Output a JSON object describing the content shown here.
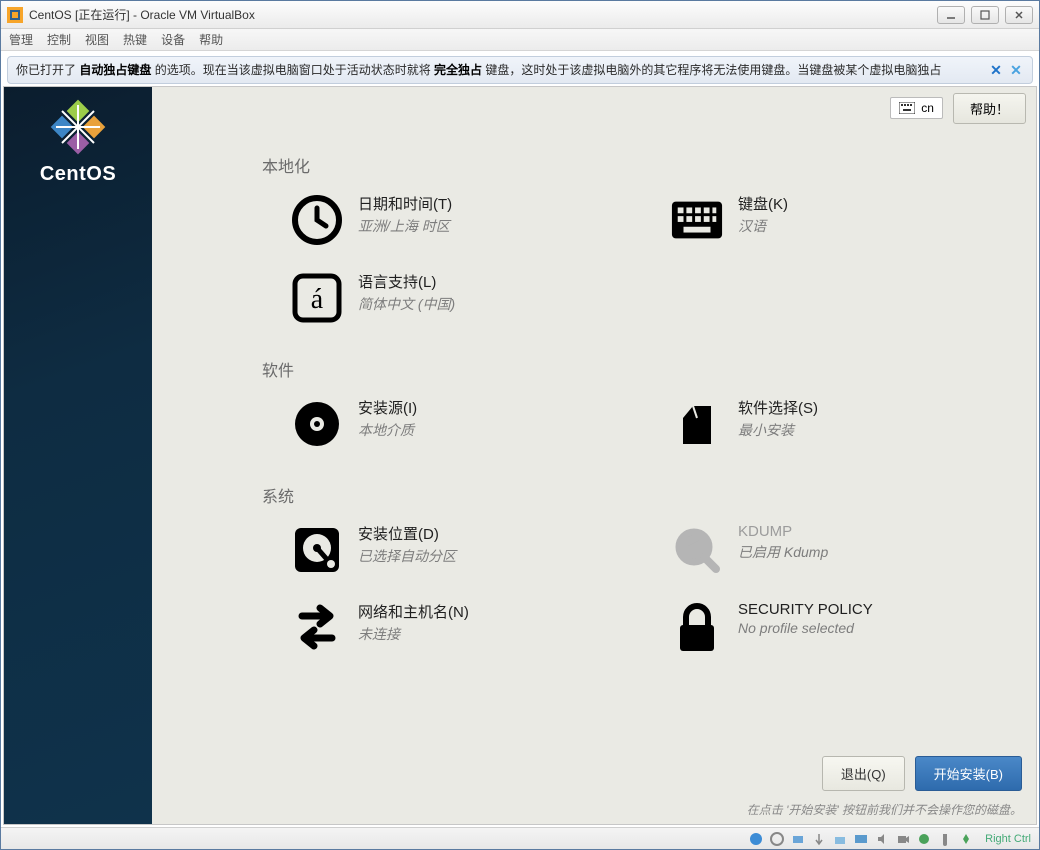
{
  "window": {
    "title": "CentOS [正在运行] - Oracle VM VirtualBox"
  },
  "menubar": [
    "管理",
    "控制",
    "视图",
    "热键",
    "设备",
    "帮助"
  ],
  "banner": {
    "p1": "你已打开了 ",
    "b1": "自动独占键盘",
    "p2": " 的选项。现在当该虚拟电脑窗口处于活动状态时就将 ",
    "b2": "完全独占",
    "p3": " 键盘，这时处于该虚拟电脑外的其它程序将无法使用键盘。当键盘被某个虚拟电脑独占"
  },
  "installer": {
    "brand": "CentOS",
    "kb_layout": "cn",
    "help": "帮助！",
    "sections": {
      "localization": "本地化",
      "software": "软件",
      "system": "系统"
    },
    "spokes": {
      "datetime": {
        "title": "日期和时间(T)",
        "sub": "亚洲/上海 时区"
      },
      "keyboard": {
        "title": "键盘(K)",
        "sub": "汉语"
      },
      "lang": {
        "title": "语言支持(L)",
        "sub": "简体中文 (中国)"
      },
      "source": {
        "title": "安装源(I)",
        "sub": "本地介质"
      },
      "swsel": {
        "title": "软件选择(S)",
        "sub": "最小安装"
      },
      "dest": {
        "title": "安装位置(D)",
        "sub": "已选择自动分区"
      },
      "kdump": {
        "title": "KDUMP",
        "sub": "已启用 Kdump"
      },
      "network": {
        "title": "网络和主机名(N)",
        "sub": "未连接"
      },
      "secpol": {
        "title": "SECURITY POLICY",
        "sub": "No profile selected"
      }
    },
    "hint": "在点击 '开始安装' 按钮前我们并不会操作您的磁盘。",
    "quit": "退出(Q)",
    "begin": "开始安装(B)"
  },
  "statusbar": {
    "hostkey": "Right Ctrl"
  }
}
